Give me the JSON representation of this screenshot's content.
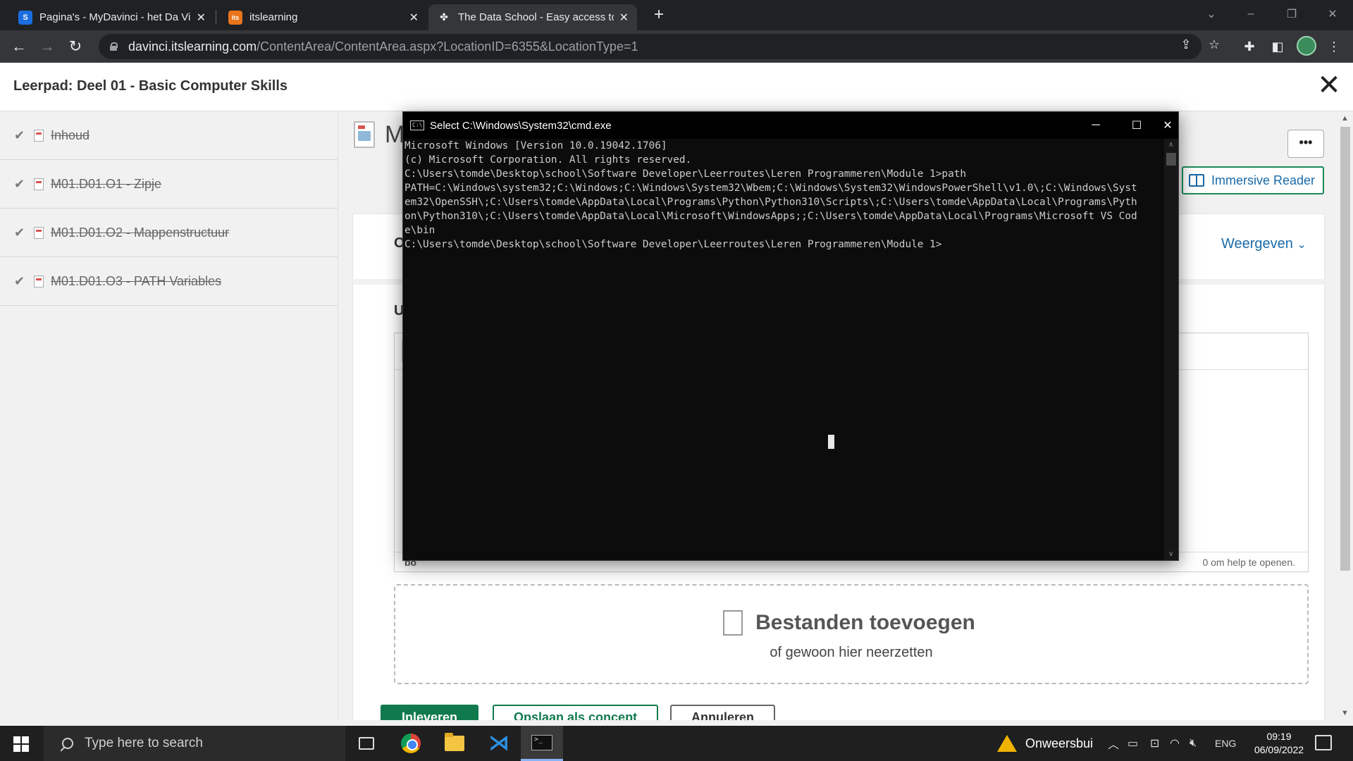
{
  "browser": {
    "tabs": [
      {
        "favicon": "S",
        "favicon_color": "#1a6ee0",
        "title": "Pagina's - MyDavinci - het Da Vin",
        "active": false
      },
      {
        "favicon": "its",
        "favicon_color": "#e8741c",
        "title": "itslearning",
        "active": false
      },
      {
        "favicon": "DS",
        "favicon_color": "#5f6368",
        "title": "The Data School - Easy access to",
        "active": true
      }
    ],
    "new_tab_label": "+",
    "url_host": "davinci.itslearning.com",
    "url_path": "/ContentArea/ContentArea.aspx?LocationID=6355&LocationType=1"
  },
  "page": {
    "title": "Leerpad: Deel 01 - Basic Computer Skills",
    "close_glyph": "✕"
  },
  "sidebar": {
    "items": [
      {
        "label": "Inhoud"
      },
      {
        "label": "M01.D01.O1 - Zipje"
      },
      {
        "label": "M01.D01.O2 - Mappenstructuur"
      },
      {
        "label": "M01.D01.O3 - PATH Variables"
      }
    ]
  },
  "main": {
    "title_partial": "M",
    "more_label": "•••",
    "immersive_reader": "Immersive Reader",
    "section1_partial": "Op",
    "weergeven": "Weergeven",
    "section2_partial": "Uw",
    "editor_toolbar_partial": "L",
    "editor_status_left": "bo",
    "editor_status_right": "0 om help te openen.",
    "dropzone_title": "Bestanden toevoegen",
    "dropzone_sub": "of gewoon hier neerzetten",
    "btn_submit": "Inleveren",
    "btn_draft": "Opslaan als concept",
    "btn_cancel": "Annuleren"
  },
  "cmd": {
    "title": "Select C:\\Windows\\System32\\cmd.exe",
    "lines": [
      "Microsoft Windows [Version 10.0.19042.1706]",
      "(c) Microsoft Corporation. All rights reserved.",
      "",
      "C:\\Users\\tomde\\Desktop\\school\\Software Developer\\Leerroutes\\Leren Programmeren\\Module 1>path",
      "PATH=C:\\Windows\\system32;C:\\Windows;C:\\Windows\\System32\\Wbem;C:\\Windows\\System32\\WindowsPowerShell\\v1.0\\;C:\\Windows\\Syst",
      "em32\\OpenSSH\\;C:\\Users\\tomde\\AppData\\Local\\Programs\\Python\\Python310\\Scripts\\;C:\\Users\\tomde\\AppData\\Local\\Programs\\Pyth",
      "on\\Python310\\;C:\\Users\\tomde\\AppData\\Local\\Microsoft\\WindowsApps;;C:\\Users\\tomde\\AppData\\Local\\Programs\\Microsoft VS Cod",
      "e\\bin",
      "",
      "C:\\Users\\tomde\\Desktop\\school\\Software Developer\\Leerroutes\\Leren Programmeren\\Module 1>"
    ]
  },
  "taskbar": {
    "search_placeholder": "Type here to search",
    "weather": "Onweersbui",
    "language": "ENG",
    "time": "09:19",
    "date": "06/09/2022"
  }
}
